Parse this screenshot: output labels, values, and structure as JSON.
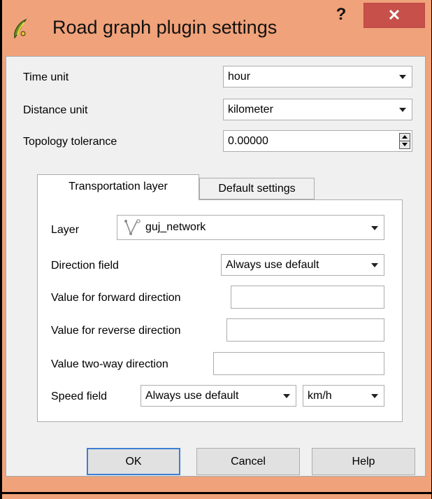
{
  "window": {
    "title": "Road graph plugin settings",
    "help_glyph": "?",
    "close_glyph": "✕"
  },
  "general": {
    "time_unit_label": "Time unit",
    "time_unit_value": "hour",
    "distance_unit_label": "Distance unit",
    "distance_unit_value": "kilometer",
    "topology_tolerance_label": "Topology tolerance",
    "topology_tolerance_value": "0.00000"
  },
  "tabs": [
    {
      "label": "Transportation layer",
      "active": true
    },
    {
      "label": "Default settings",
      "active": false
    }
  ],
  "transport": {
    "layer_label": "Layer",
    "layer_value": "guj_network",
    "direction_field_label": "Direction field",
    "direction_field_value": "Always use default",
    "forward_label": "Value for forward direction",
    "forward_value": "",
    "reverse_label": "Value for reverse direction",
    "reverse_value": "",
    "twoway_label": "Value two-way direction",
    "twoway_value": "",
    "speed_field_label": "Speed field",
    "speed_field_value": "Always use default",
    "speed_unit_value": "km/h"
  },
  "buttons": {
    "ok": "OK",
    "cancel": "Cancel",
    "help": "Help"
  },
  "colors": {
    "titlebar": "#f0a27a",
    "close_button": "#c7504a",
    "default_button_border": "#3c7fd4",
    "client_background": "#f0f0f0"
  },
  "icons": {
    "app": "qgis-icon",
    "layer": "line-layer-icon"
  }
}
